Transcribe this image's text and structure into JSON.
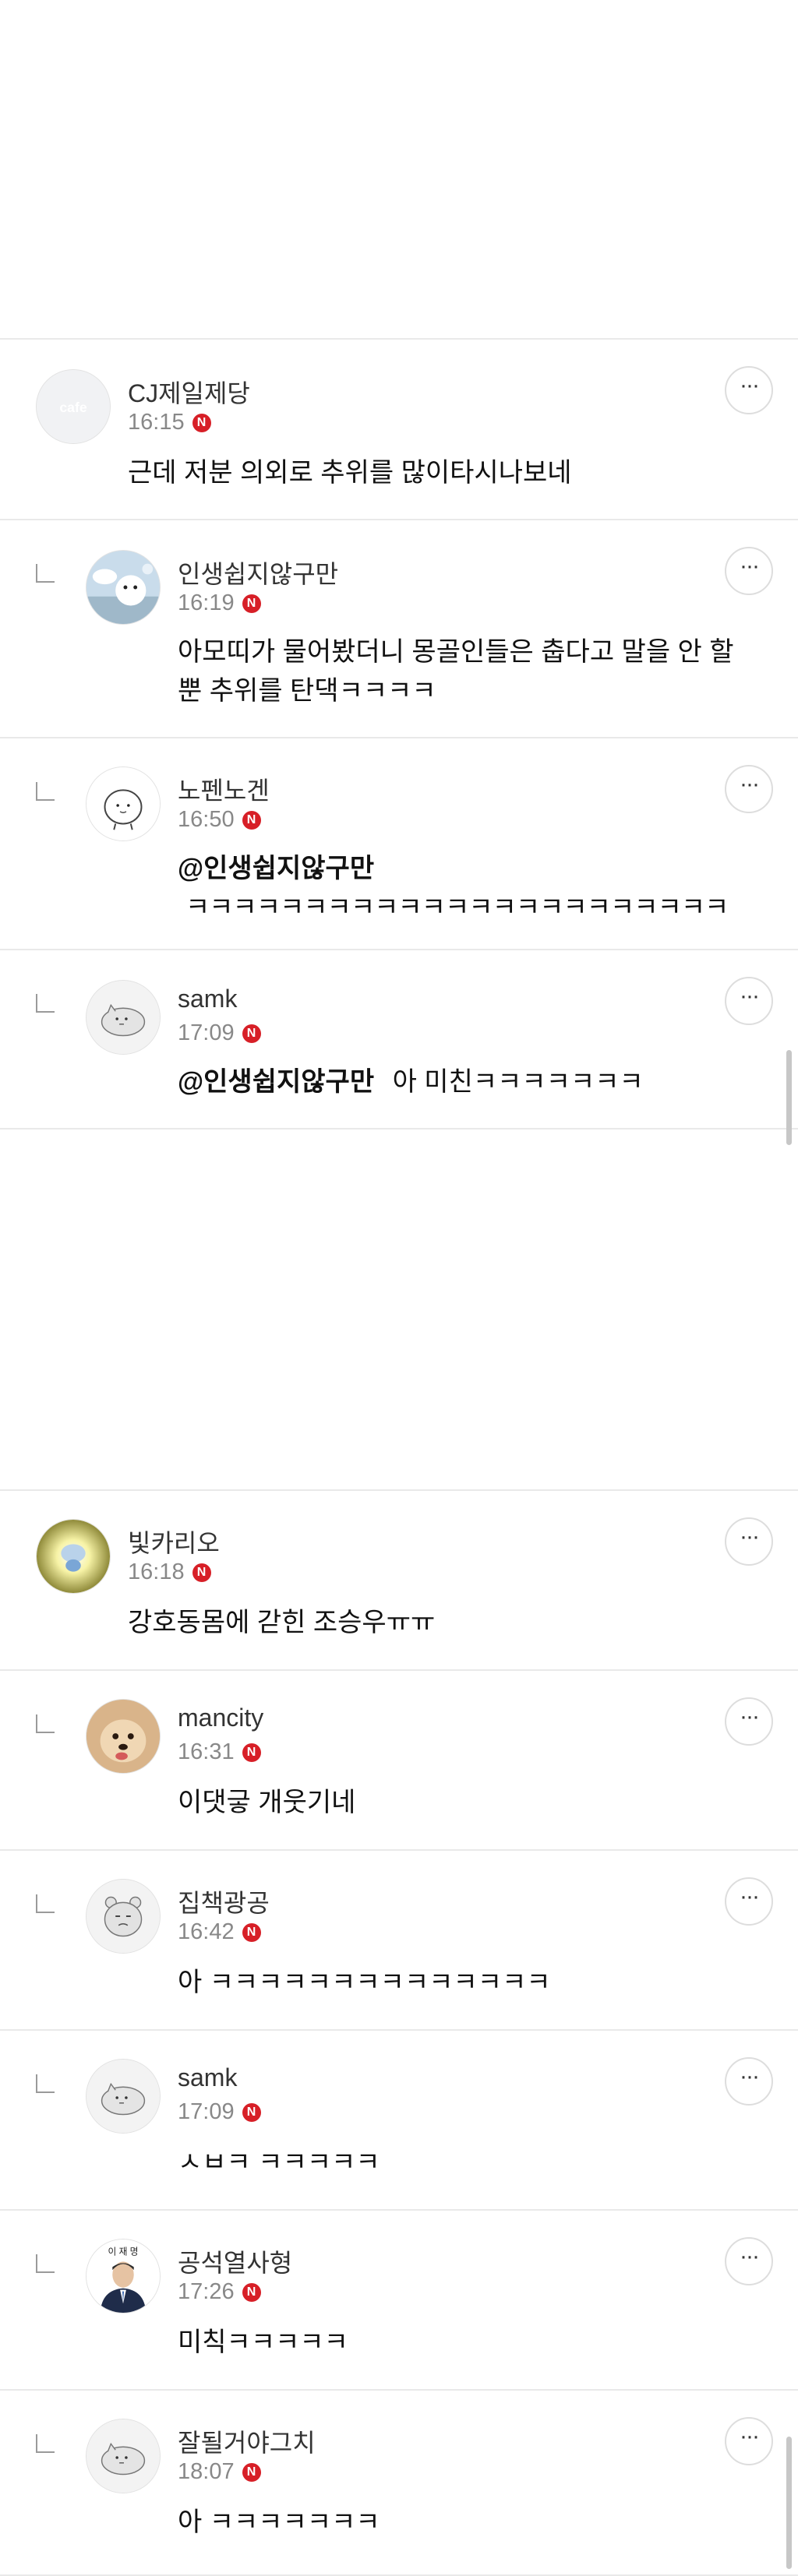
{
  "threads": [
    {
      "comments": [
        {
          "author": "CJ제일제당",
          "time": "16:15",
          "mention": "",
          "text": "근데 저분 의외로 추위를 많이타시나보네",
          "avatar": "cafe-default-avatar"
        },
        {
          "author": "인생쉽지않구만",
          "time": "16:19",
          "mention": "",
          "text": "아모띠가 물어봤더니 몽골인들은 춥다고 말을 안 할뿐 추위를 탄댁ㅋㅋㅋㅋ",
          "avatar": "character-avatar"
        },
        {
          "author": "노펜노겐",
          "time": "16:50",
          "mention": "@인생쉽지않구만",
          "text": "ㅋㅋㅋㅋㅋㅋㅋㅋㅋㅋㅋㅋㅋㅋㅋㅋㅋㅋㅋㅋㅋㅋㅋ",
          "avatar": "doodle-avatar"
        },
        {
          "author": "samk",
          "time": "17:09",
          "mention": "@인생쉽지않구만",
          "text": "아 미친ㅋㅋㅋㅋㅋㅋㅋ",
          "avatar": "cat-doodle-avatar"
        }
      ]
    },
    {
      "comments": [
        {
          "author": "빛카리오",
          "time": "16:18",
          "mention": "",
          "text": "강호동몸에 갇힌 조승우ㅠㅠ",
          "avatar": "glow-avatar"
        },
        {
          "author": "mancity",
          "time": "16:31",
          "mention": "",
          "text": "이댓긓 개웃기네",
          "avatar": "dog-avatar"
        },
        {
          "author": "집책광공",
          "time": "16:42",
          "mention": "",
          "text": "아 ㅋㅋㅋㅋㅋㅋㅋㅋㅋㅋㅋㅋㅋㅋ",
          "avatar": "bear-doodle-avatar"
        },
        {
          "author": "samk",
          "time": "17:09",
          "mention": "",
          "text": "ㅅㅂㅋ ㅋㅋㅋㅋㅋ",
          "avatar": "cat-doodle-avatar"
        },
        {
          "author": "공석열사형",
          "time": "17:26",
          "mention": "",
          "text": "미칙ㅋㅋㅋㅋㅋ",
          "avatar": "portrait-avatar"
        },
        {
          "author": "잘될거야그치",
          "time": "18:07",
          "mention": "",
          "text": "아 ㅋㅋㅋㅋㅋㅋㅋ",
          "avatar": "cat-doodle-avatar"
        }
      ]
    }
  ],
  "avatar_label_cafe": "cafe",
  "avatar_label_portrait": "이 재 명",
  "badge_letter": "N",
  "more_icon": "more-horizontal-icon",
  "colors": {
    "badge": "#d71f27",
    "divider": "#e9e9e9",
    "meta": "#888888"
  }
}
